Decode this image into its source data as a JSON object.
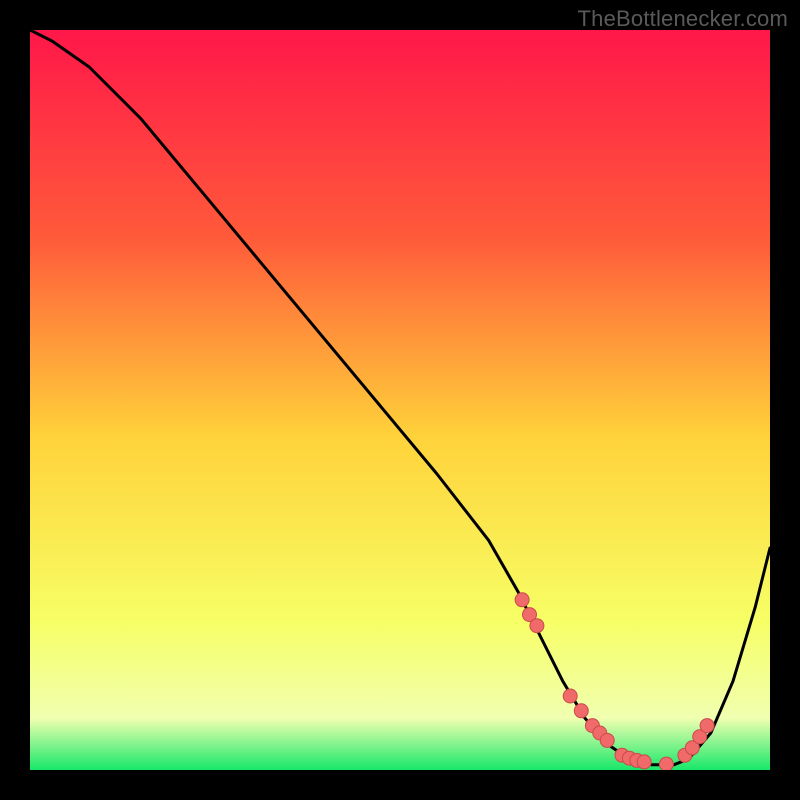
{
  "watermark": "TheBottlenecker.com",
  "colors": {
    "bg_black": "#000000",
    "curve": "#000000",
    "marker_fill": "#f06a6a",
    "marker_stroke": "#c94b4b",
    "grad_top": "#ff1749",
    "grad_upper": "#ff5a3a",
    "grad_mid": "#ffd23a",
    "grad_lower": "#f7ff66",
    "grad_pale": "#f0ffb0",
    "grad_green": "#17e86a"
  },
  "chart_data": {
    "type": "line",
    "title": "",
    "xlabel": "",
    "ylabel": "",
    "xlim": [
      0,
      100
    ],
    "ylim": [
      0,
      100
    ],
    "series": [
      {
        "name": "curve",
        "x": [
          0,
          3,
          8,
          15,
          25,
          35,
          45,
          55,
          62,
          66,
          69,
          72,
          75,
          78,
          81,
          84,
          87,
          89,
          92,
          95,
          98,
          100
        ],
        "y": [
          100,
          98.5,
          95,
          88,
          76,
          64,
          52,
          40,
          31,
          24,
          18,
          12,
          7,
          3.5,
          1.5,
          0.7,
          0.7,
          1.5,
          5,
          12,
          22,
          30
        ]
      }
    ],
    "markers": {
      "name": "highlight-points",
      "x": [
        66.5,
        67.5,
        68.5,
        73,
        74.5,
        76,
        77,
        78,
        80,
        81,
        82,
        83,
        86,
        88.5,
        89.5,
        90.5,
        91.5
      ],
      "y": [
        23,
        21,
        19.5,
        10,
        8,
        6,
        5,
        4,
        2,
        1.6,
        1.3,
        1.1,
        0.8,
        2,
        3,
        4.5,
        6
      ]
    }
  }
}
